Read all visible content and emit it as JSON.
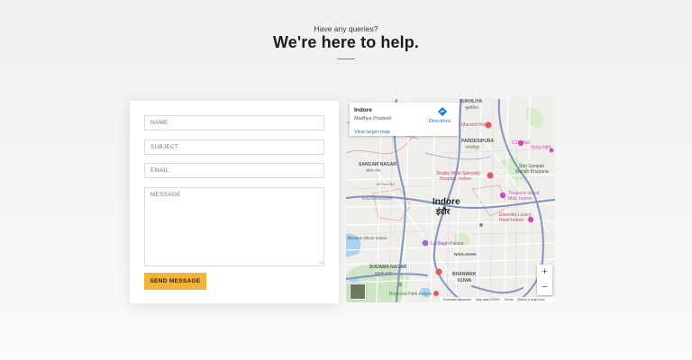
{
  "hero": {
    "eyebrow": "Have any queries?",
    "headline": "We're here to help."
  },
  "form": {
    "name_placeholder": "NAME",
    "subject_placeholder": "SUBJECT",
    "email_placeholder": "EMAIL",
    "message_placeholder": "MESSAGE",
    "submit_label": "SEND MESSAGE",
    "submit_color": "#f2b53a"
  },
  "map": {
    "info": {
      "title": "Indore",
      "subtitle": "Madhya Pradesh",
      "directions": "Directions",
      "larger_map": "View larger map"
    },
    "zoom_in": "+",
    "zoom_out": "−",
    "attribution": {
      "shortcuts": "Keyboard shortcuts",
      "data": "Map data ©2025",
      "terms": "Terms",
      "report": "Report a map error"
    },
    "labels": {
      "sukhliya": "SUKHLIYA",
      "sukhliya_hi": "सुखलिया",
      "marriott": "e Marriott Hotel",
      "pardesipura": "PARDESIPURA",
      "pardesipura_hi": "परदेसीपुरा",
      "c21": "C21 Mall",
      "vicky": "Vicky light",
      "sangam": "SANGAM NAGAR",
      "sangam_hi": "संगम नगर",
      "shalby": "Shalby Multi-Specialty",
      "shalby2": "Hospital, Indore",
      "shri": "Shri Ganpati",
      "shri2": "Mandir Khajrana",
      "road60": "60 Feet Rd",
      "kalani": "KALANI NAGAR",
      "indore": "Indore",
      "indore_hi": "इंदौर",
      "treasure": "Treasure Island",
      "treasure2": "Mall, Indore",
      "essentia": "Essentia Luxury",
      "essentia2": "Hotel Indore",
      "bhuwan": "Bhuwan Dham Indore",
      "lalbagh": "Lal Bagh Palace",
      "navlakha": "NAVLAKHA",
      "sudama": "SUDAMA NAGAR",
      "sudama_hi": "सुदामा नगर",
      "bhanwar": "BHANWAR",
      "kuwa": "KUWA",
      "regional": "Regional Park Indore"
    }
  }
}
